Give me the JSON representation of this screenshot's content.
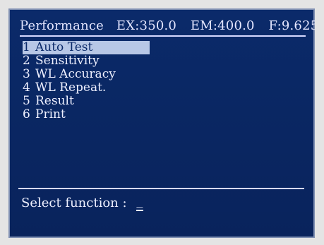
{
  "header": {
    "title": "Performance",
    "ex": "EX:350.0",
    "em": "EM:400.0",
    "f": "F:9.625"
  },
  "menu": {
    "items": [
      {
        "num": "1",
        "label": "Auto Test"
      },
      {
        "num": "2",
        "label": "Sensitivity"
      },
      {
        "num": "3",
        "label": "WL Accuracy"
      },
      {
        "num": "4",
        "label": "WL Repeat."
      },
      {
        "num": "5",
        "label": "Result"
      },
      {
        "num": "6",
        "label": "Print"
      }
    ],
    "selected_index": 0
  },
  "prompt": {
    "text": "Select function :",
    "cursor": "_"
  },
  "colors": {
    "screen_bg": "#0a2763",
    "text": "#eef0ff",
    "highlight": "#b7c7e6"
  }
}
